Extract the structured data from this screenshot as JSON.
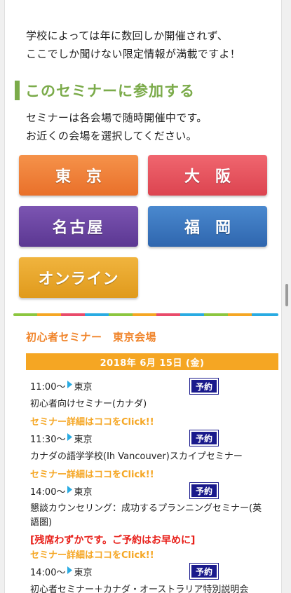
{
  "intro": {
    "line1": "学校によっては年に数回しか開催されず、",
    "line2": "ここでしか聞けない限定情報が満載ですよ！"
  },
  "section": {
    "heading": "このセミナーに参加する",
    "lead1": "セミナーは各会場で随時開催中です。",
    "lead2": "お近くの会場を選択してください。"
  },
  "venues": {
    "tokyo": "東京",
    "osaka": "大阪",
    "nagoya": "名古屋",
    "fukuoka": "福岡",
    "online": "オンライン"
  },
  "seminar": {
    "title": "初心者セミナー　東京会場",
    "date": "2018年 6月 15日 (金)",
    "reserve_label": "予約",
    "events": [
      {
        "time": "11:00〜",
        "place": "東京",
        "name": "初心者向けセミナー(カナダ)",
        "link": "セミナー詳細はココをClick!!"
      },
      {
        "time": "11:30〜",
        "place": "東京",
        "name": "カナダの語学学校(Ih Vancouver)スカイプセミナー",
        "link": "セミナー詳細はココをClick!!"
      },
      {
        "time": "14:00〜",
        "place": "東京",
        "name_line1": "懇談カウンセリング：成功するプランニングセミナー(英",
        "name_line2": "語圏)",
        "alert": "[残席わずかです。ご予約はお早めに]",
        "link": "セミナー詳細はココをClick!!"
      },
      {
        "time": "14:00〜",
        "place": "東京",
        "name": "初心者セミナー＋カナダ・オーストラリア特別説明会"
      }
    ]
  },
  "colors": {
    "accent_green": "#7bab4a",
    "accent_orange": "#f0842a",
    "date_bar": "#f5a623",
    "reserve_button": "#1a1a8c",
    "alert_red": "#e8201a"
  }
}
